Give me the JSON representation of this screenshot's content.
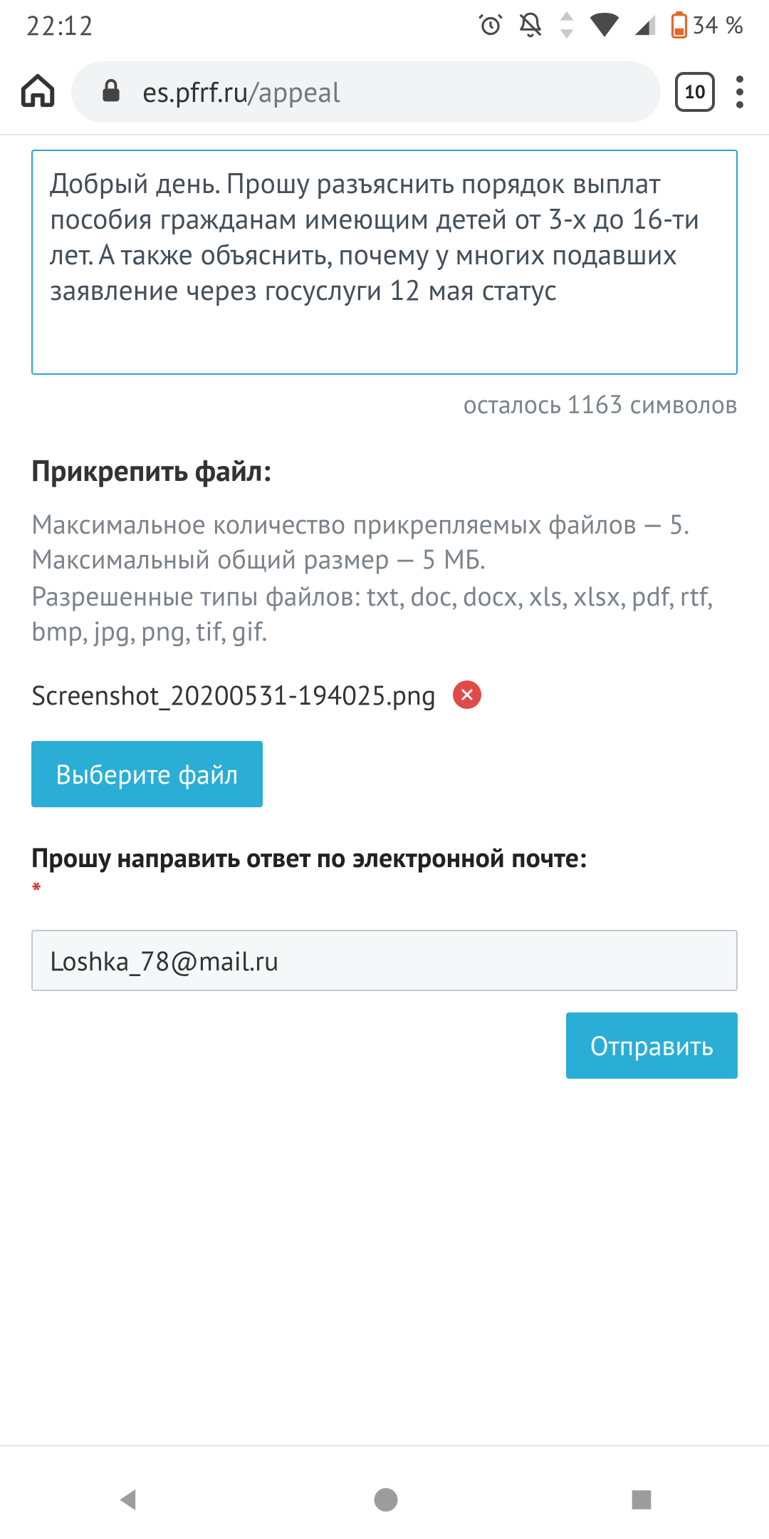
{
  "status": {
    "time": "22:12",
    "battery_pct": "34 %"
  },
  "browser": {
    "domain": "es.pfrf.ru",
    "path": "/appeal",
    "tab_count": "10"
  },
  "form": {
    "message_text": "Добрый день. Прошу разъяснить порядок выплат пособия гражданам имеющим детей от 3-х до 16-ти лет. А также объяснить, почему у многих подавших заявление через госуслуги 12 мая статус",
    "counter": "осталось 1163 символов",
    "attach_title": "Прикрепить файл:",
    "attach_help1": "Максимальное количество прикрепляемых файлов — 5. Максимальный общий размер — 5 МБ.",
    "attach_help2": "Разрешенные типы файлов: txt, doc, docx, xls, xlsx, pdf, rtf, bmp, jpg, png, tif, gif.",
    "attached_file": "Screenshot_20200531-194025.png",
    "choose_file_label": "Выберите файл",
    "email_label": "Прошу направить ответ по электронной почте:",
    "required_mark": "*",
    "email_value": "Loshka_78@mail.ru",
    "submit_label": "Отправить"
  }
}
